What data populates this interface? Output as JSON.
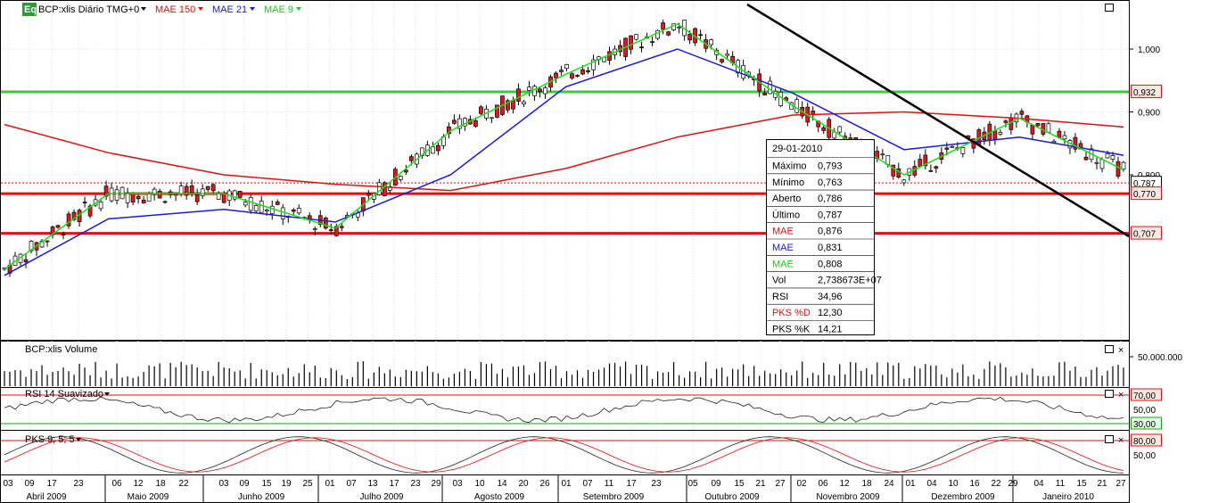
{
  "header": {
    "logo": "Eq",
    "instrument": "BCP:xlis Diário TMG+0",
    "mae150": "MAE 150",
    "mae21": "MAE 21",
    "mae9": "MAE 9"
  },
  "colors": {
    "mae150": "#e01010",
    "mae21": "#1a1ad8",
    "mae9": "#18e018",
    "hline_green": "#30d030",
    "hline_red": "#e01010",
    "trend": "#000000",
    "candle_up": "#ffffff",
    "candle_down": "#d02020"
  },
  "price_axis": {
    "ticks": [
      "1,000",
      "0,900",
      "0,800"
    ],
    "tick_values": [
      1.0,
      0.9,
      0.8
    ]
  },
  "price_labels": [
    {
      "text": "0,932",
      "value": 0.932,
      "kind": "green"
    },
    {
      "text": "0,787",
      "value": 0.787,
      "kind": "last"
    },
    {
      "text": "0,770",
      "value": 0.77,
      "kind": "red"
    },
    {
      "text": "0,707",
      "value": 0.707,
      "kind": "red"
    }
  ],
  "tooltip": {
    "date": "29-01-2010",
    "rows": [
      {
        "label": "Máximo",
        "value": "0,793",
        "color": "#000000"
      },
      {
        "label": "Mínimo",
        "value": "0,763",
        "color": "#000000"
      },
      {
        "label": "Aberto",
        "value": "0,786",
        "color": "#000000"
      },
      {
        "label": "Último",
        "value": "0,787",
        "color": "#000000"
      },
      {
        "label": "MAE",
        "value": "0,876",
        "color": "#e01010"
      },
      {
        "label": "MAE",
        "value": "0,831",
        "color": "#1a1ad8"
      },
      {
        "label": "MAE",
        "value": "0,808",
        "color": "#18c818"
      },
      {
        "label": "Vol",
        "value": "2,738673E+07",
        "color": "#000000"
      },
      {
        "label": "RSI",
        "value": "34,96",
        "color": "#000000"
      },
      {
        "label": "PKS %D",
        "value": "12,30",
        "color": "#e01010"
      },
      {
        "label": "PKS %K",
        "value": "14,21",
        "color": "#000000"
      }
    ]
  },
  "volume_panel": {
    "title": "BCP:xlis Volume",
    "tick": "50.000.000"
  },
  "rsi_panel": {
    "title": "RSI 14 Suavizado",
    "ticks": [
      "70,00",
      "50,00",
      "30,00"
    ]
  },
  "pks_panel": {
    "title": "PKS 9; 5; 5",
    "ticks": [
      "80,00",
      "50,00"
    ]
  },
  "x_axis": {
    "days": [
      "03",
      "09",
      "17",
      "23",
      "06",
      "12",
      "18",
      "22",
      "03",
      "09",
      "15",
      "19",
      "25",
      "01",
      "07",
      "13",
      "17",
      "23",
      "29",
      "03",
      "10",
      "14",
      "20",
      "26",
      "01",
      "07",
      "11",
      "17",
      "23",
      "05",
      "09",
      "15",
      "21",
      "27",
      "02",
      "06",
      "12",
      "18",
      "24",
      "01",
      "04",
      "10",
      "16",
      "22",
      "29",
      "04",
      "11",
      "15",
      "21",
      "27"
    ],
    "months": [
      "Abril 2009",
      "Maio 2009",
      "Junho 2009",
      "Julho 2009",
      "Agosto 2009",
      "Setembro 2009",
      "Outubro 2009",
      "Novembro 2009",
      "Dezembro 2009",
      "Janeiro 2010"
    ]
  },
  "chart_data": {
    "type": "candlestick",
    "x_range": [
      "2009-04-03",
      "2010-01-29"
    ],
    "ylim": [
      0.6,
      1.07
    ],
    "series": [
      {
        "name": "MAE 150",
        "x": [
          "2009-04-03",
          "2009-05-01",
          "2009-06-01",
          "2009-07-01",
          "2009-08-01",
          "2009-09-01",
          "2009-10-01",
          "2009-11-01",
          "2009-12-01",
          "2010-01-01",
          "2010-01-29"
        ],
        "values": [
          0.88,
          0.835,
          0.8,
          0.785,
          0.775,
          0.81,
          0.86,
          0.895,
          0.9,
          0.89,
          0.876
        ]
      },
      {
        "name": "MAE 21",
        "x": [
          "2009-04-03",
          "2009-05-01",
          "2009-06-01",
          "2009-07-01",
          "2009-08-01",
          "2009-09-01",
          "2009-10-01",
          "2009-11-01",
          "2009-12-01",
          "2010-01-01",
          "2010-01-29"
        ],
        "values": [
          0.64,
          0.73,
          0.745,
          0.725,
          0.8,
          0.94,
          1.0,
          0.93,
          0.84,
          0.86,
          0.831
        ]
      },
      {
        "name": "MAE 9",
        "x": [
          "2009-04-03",
          "2009-05-01",
          "2009-06-01",
          "2009-07-01",
          "2009-08-01",
          "2009-09-01",
          "2009-10-01",
          "2009-11-01",
          "2009-12-01",
          "2010-01-01",
          "2010-01-29"
        ],
        "values": [
          0.65,
          0.77,
          0.77,
          0.715,
          0.87,
          0.96,
          1.04,
          0.91,
          0.8,
          0.89,
          0.808
        ]
      }
    ],
    "last": {
      "date": "2010-01-29",
      "high": 0.793,
      "low": 0.763,
      "open": 0.786,
      "close": 0.787,
      "volume": 27386730,
      "rsi": 34.96,
      "pks_d": 12.3,
      "pks_k": 14.21
    },
    "horizontal_lines": [
      0.932,
      0.77,
      0.707
    ],
    "rsi_levels": [
      70,
      30
    ],
    "pks_levels": [
      80,
      50
    ]
  }
}
